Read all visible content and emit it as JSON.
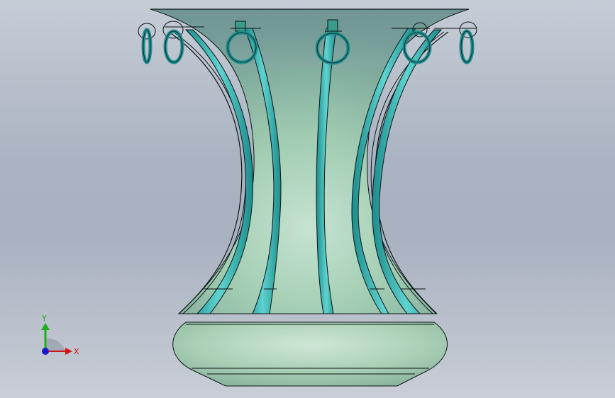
{
  "viewport": {
    "background_top": "#c6cdd7",
    "background_bottom": "#c9ced6"
  },
  "model": {
    "body_color": "#a6cfb4",
    "body_shade": "#6f9a92",
    "strap_color": "#2aa6a6",
    "edge_color": "#0b1414",
    "ring_count": 8,
    "strap_count": 8
  },
  "triad": {
    "y_label": "Y",
    "x_label": "X",
    "y_color": "#1bb01b",
    "x_color": "#d21414",
    "z_color": "#1a1ad0"
  }
}
